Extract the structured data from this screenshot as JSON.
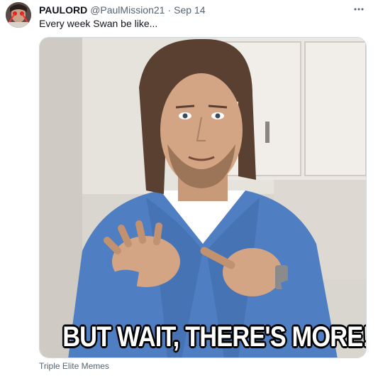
{
  "tweet": {
    "display_name": "PAULORD",
    "handle": "@PaulMission21",
    "separator": "·",
    "date": "Sep 14",
    "more_icon": "more-horizontal-icon",
    "text": "Every week Swan be like...",
    "media": {
      "caption": "BUT WAIT, THERE'S MORE!",
      "description_icon": "meme-photo"
    },
    "source_label": "Triple Elite Memes"
  },
  "colors": {
    "primary_text": "#0f1419",
    "secondary_text": "#536471",
    "border": "#cfd9de",
    "shirt_blue": "#4f7fc2"
  }
}
